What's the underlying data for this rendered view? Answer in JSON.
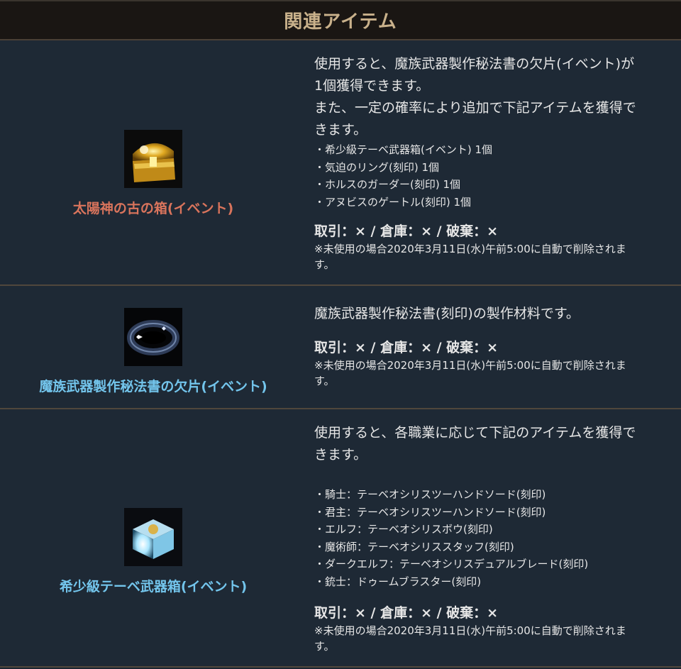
{
  "header": {
    "title": "関連アイテム"
  },
  "colors": {
    "item1_name": "#d9745c",
    "item2_name": "#73c5ec",
    "item3_name": "#73c5ec"
  },
  "items": [
    {
      "name": "太陽神の古の箱(イベント)",
      "icon": "golden-treasure-chest-icon",
      "desc": [
        "使用すると、魔族武器製作秘法書の欠片(イベント)が",
        "1個獲得できます。",
        "また、一定の確率により追加で下記アイテムを獲得で",
        "きます。"
      ],
      "list": [
        "・希少級テーベ武器箱(イベント) 1個",
        "・気迫のリング(刻印) 1個",
        "・ホルスのガーダー(刻印) 1個",
        "・アヌビスのゲートル(刻印) 1個"
      ],
      "rules": "取引：× / 倉庫：× / 破棄：×",
      "note": [
        "※未使用の場合2020年3月11日(水)午前5:00に自動で削除されま",
        "す。"
      ]
    },
    {
      "name": "魔族武器製作秘法書の欠片(イベント)",
      "icon": "dark-fragment-icon",
      "desc": [
        "魔族武器製作秘法書(刻印)の製作材料です。"
      ],
      "rules": "取引：× / 倉庫：× / 破棄：×",
      "note": [
        "※未使用の場合2020年3月11日(水)午前5:00に自動で削除されま",
        "す。"
      ]
    },
    {
      "name": "希少級テーベ武器箱(イベント)",
      "icon": "glowing-weapon-box-icon",
      "desc": [
        "使用すると、各職業に応じて下記のアイテムを獲得で",
        "きます。"
      ],
      "list": [
        "・騎士：テーベオシリスツーハンドソード(刻印)",
        "・君主：テーベオシリスツーハンドソード(刻印)",
        "・エルフ：テーベオシリスボウ(刻印)",
        "・魔術師：テーベオシリススタッフ(刻印)",
        "・ダークエルフ：テーベオシリスデュアルブレード(刻印)",
        "・銃士：ドゥームブラスター(刻印)"
      ],
      "rules": "取引：× / 倉庫：× / 破棄：×",
      "note": [
        "※未使用の場合2020年3月11日(水)午前5:00に自動で削除されま",
        "す。"
      ]
    }
  ]
}
